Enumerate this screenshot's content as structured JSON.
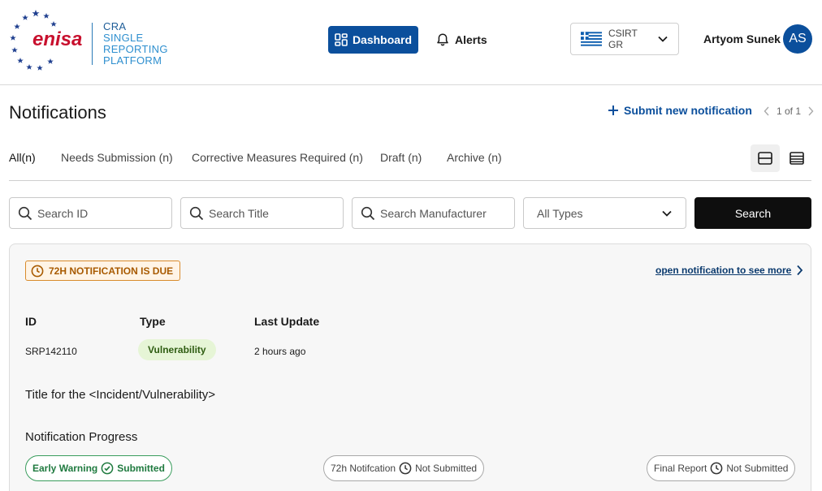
{
  "header": {
    "logo_text": "enisa",
    "platform_name": [
      "CRA",
      "SINGLE",
      "REPORTING",
      "PLATFORM"
    ],
    "nav": {
      "dashboard_label": "Dashboard",
      "alerts_label": "Alerts"
    },
    "country_select": {
      "value": "CSIRT GR"
    },
    "user": {
      "name": "Artyom Sunek",
      "initials": "AS"
    }
  },
  "page": {
    "title": "Notifications",
    "submit_new_label": "Submit new notification",
    "pager": "1 of 1"
  },
  "tabs": [
    {
      "label": "All(n)",
      "active": true
    },
    {
      "label": "Needs Submission (n)",
      "active": false
    },
    {
      "label": "Corrective Measures Required (n)",
      "active": false
    },
    {
      "label": "Draft (n)",
      "active": false
    },
    {
      "label": "Archive (n)",
      "active": false
    }
  ],
  "filters": {
    "search_id_placeholder": "Search ID",
    "search_title_placeholder": "Search Title",
    "search_manufacturer_placeholder": "Search Manufacturer",
    "type_select_value": "All Types",
    "search_button_label": "Search"
  },
  "notification": {
    "due_badge": "72H NOTIFICATION IS DUE",
    "open_link": "open notification to see more",
    "columns": {
      "id": "ID",
      "type": "Type",
      "last_update": "Last Update"
    },
    "id": "SRP142110",
    "type": "Vulnerability",
    "last_update": "2 hours ago",
    "title": "Title for the <Incident/Vulnerability>",
    "progress_label": "Notification Progress",
    "stages": [
      {
        "name": "Early Warning",
        "status": "Submitted"
      },
      {
        "name": "72h Notifcation",
        "status": "Not Submitted"
      },
      {
        "name": "Final Report",
        "status": "Not Submitted"
      }
    ]
  },
  "colors": {
    "primary": "#0b4f9c",
    "logo_red": "#c8102e",
    "star_blue": "#1f3f8f",
    "due_orange": "#d98b2b",
    "success_green": "#1f7a3f",
    "chip_green_bg": "#e6f5d6"
  }
}
